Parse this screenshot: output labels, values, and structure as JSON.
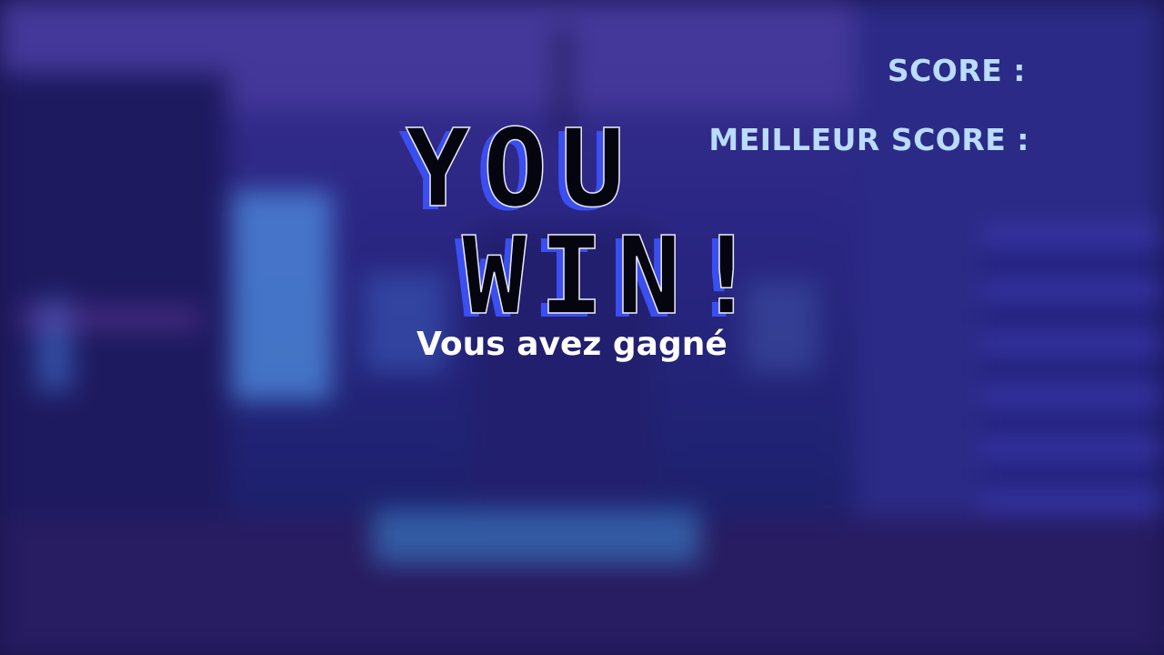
{
  "hud": {
    "score_label": "SCORE :",
    "best_score_label": "MEILLEUR SCORE :"
  },
  "title": {
    "line1": "YOU",
    "line2": "WIN!",
    "subtitle": "Vous avez gagné"
  },
  "colors": {
    "hud_text": "#b9dcff",
    "title_fill": "#050510",
    "title_shadow": "#3b4ef0",
    "subtitle": "#ffffff",
    "background": "#2a2683"
  }
}
